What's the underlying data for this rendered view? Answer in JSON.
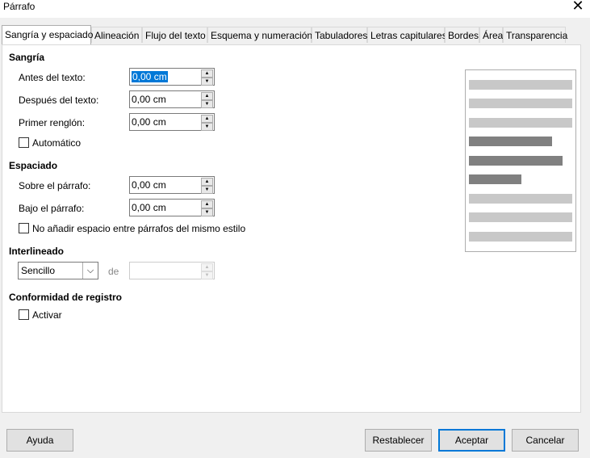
{
  "window": {
    "title": "Párrafo"
  },
  "tabs": [
    {
      "label": "Sangría y espaciado"
    },
    {
      "label": "Alineación"
    },
    {
      "label": "Flujo del texto"
    },
    {
      "label": "Esquema y numeración"
    },
    {
      "label": "Tabuladores"
    },
    {
      "label": "Letras capitulares"
    },
    {
      "label": "Bordes"
    },
    {
      "label": "Área"
    },
    {
      "label": "Transparencia"
    }
  ],
  "indent": {
    "heading": "Sangría",
    "before_label": "Antes del texto:",
    "before_value": "0,00 cm",
    "after_label": "Después del texto:",
    "after_value": "0,00 cm",
    "first_line_label": "Primer renglón:",
    "first_line_value": "0,00 cm",
    "automatic_label": "Automático"
  },
  "spacing": {
    "heading": "Espaciado",
    "above_label": "Sobre el párrafo:",
    "above_value": "0,00 cm",
    "below_label": "Bajo el párrafo:",
    "below_value": "0,00 cm",
    "no_space_label": "No añadir espacio entre párrafos del mismo estilo"
  },
  "line_spacing": {
    "heading": "Interlineado",
    "selected": "Sencillo",
    "of_label": "de",
    "of_value": ""
  },
  "register": {
    "heading": "Conformidad de registro",
    "activate_label": "Activar"
  },
  "buttons": {
    "help": "Ayuda",
    "reset": "Restablecer",
    "ok": "Aceptar",
    "cancel": "Cancelar"
  },
  "colors": {
    "accent": "#0078d7",
    "preview_light": "#c8c8c8",
    "preview_dark": "#808080"
  }
}
